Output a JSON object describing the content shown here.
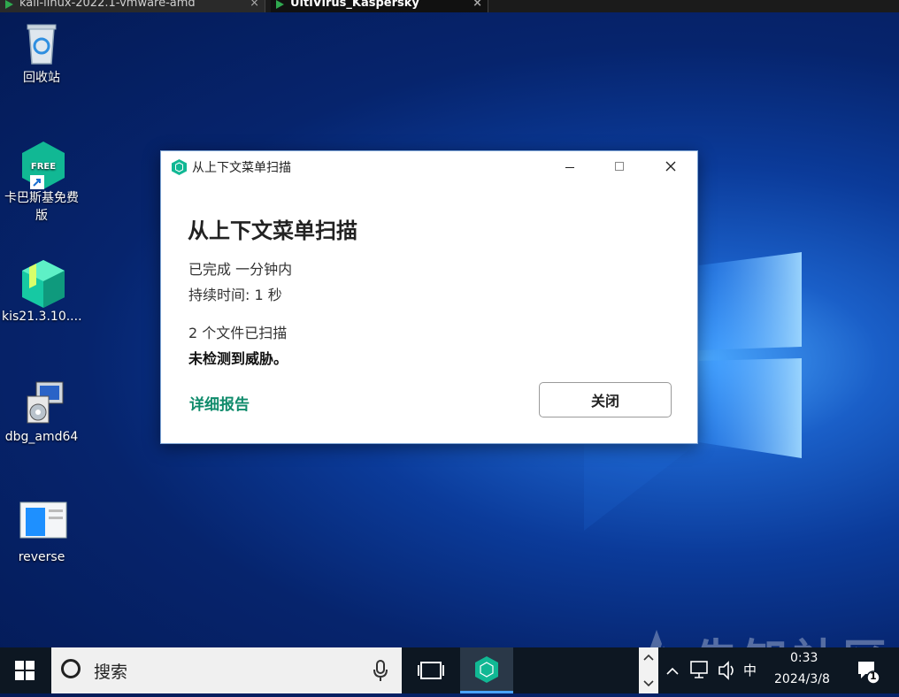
{
  "vm_tabs": [
    {
      "label": "kali-linux-2022.1-vmware-amd"
    },
    {
      "label": "UltiVirus_Kaspersky"
    }
  ],
  "desktop_icons": [
    {
      "label": "回收站"
    },
    {
      "label": "卡巴斯基免费版"
    },
    {
      "label": "kis21.3.10...."
    },
    {
      "label": "dbg_amd64"
    },
    {
      "label": "reverse"
    }
  ],
  "dialog": {
    "title": "从上下文菜单扫描",
    "heading": "从上下文菜单扫描",
    "completed": "已完成 一分钟内",
    "duration": "持续时间: 1 秒",
    "files_scanned": "2 个文件已扫描",
    "no_threats": "未检测到威胁。",
    "report_link": "详细报告",
    "close_button": "关闭"
  },
  "taskbar": {
    "search_placeholder": "搜索",
    "ime": "中",
    "time": "0:33",
    "date": "2024/3/8",
    "notification_count": "1"
  },
  "watermark": "先知社区",
  "colors": {
    "kaspersky_green": "#0f8b6b",
    "accent": "#4aa3ff"
  }
}
